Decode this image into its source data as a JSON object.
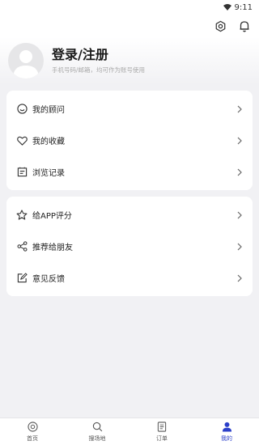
{
  "statusbar": {
    "time": "9:11",
    "wifi_icon": "wifi-icon"
  },
  "topbar": {
    "settings_icon": "gear-icon",
    "notification_icon": "bell-icon"
  },
  "profile": {
    "title": "登录/注册",
    "subtitle": "手机号码/邮箱，均可作为账号使用"
  },
  "menu": {
    "group1": [
      {
        "label": "我的顾问",
        "icon": "smile-icon"
      },
      {
        "label": "我的收藏",
        "icon": "heart-icon"
      },
      {
        "label": "浏览记录",
        "icon": "history-icon"
      }
    ],
    "group2": [
      {
        "label": "给APP评分",
        "icon": "star-icon"
      },
      {
        "label": "推荐给朋友",
        "icon": "share-icon"
      },
      {
        "label": "意见反馈",
        "icon": "feedback-icon"
      }
    ]
  },
  "tabbar": {
    "items": [
      {
        "label": "首页",
        "icon": "home-icon"
      },
      {
        "label": "搜场地",
        "icon": "search-icon"
      },
      {
        "label": "订单",
        "icon": "order-icon"
      },
      {
        "label": "我的",
        "icon": "user-icon"
      }
    ],
    "active_index": 3
  },
  "colors": {
    "accent": "#2b3fc9",
    "background": "#f1f1f4"
  }
}
